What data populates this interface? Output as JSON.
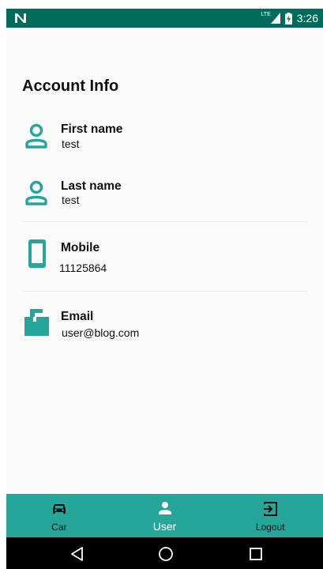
{
  "status_bar": {
    "time": "3:26",
    "network": "LTE",
    "left_icon": "notification-n-icon",
    "signal_icon": "signal-icon",
    "battery_icon": "battery-charging-icon"
  },
  "page": {
    "title": "Account Info"
  },
  "fields": [
    {
      "label": "First name",
      "value": "test",
      "icon": "person-icon"
    },
    {
      "label": "Last name",
      "value": "test",
      "icon": "person-icon"
    },
    {
      "label": "Mobile",
      "value": "11125864",
      "icon": "smartphone-icon"
    },
    {
      "label": "Email",
      "value": "user@blog.com",
      "icon": "mailbox-icon"
    }
  ],
  "bottom_nav": {
    "items": [
      {
        "label": "Car",
        "icon": "car-icon",
        "active": false
      },
      {
        "label": "User",
        "icon": "user-icon",
        "active": true
      },
      {
        "label": "Logout",
        "icon": "logout-icon",
        "active": false
      }
    ]
  },
  "system_nav": {
    "back_icon": "back-icon",
    "home_icon": "home-icon",
    "recents_icon": "recents-icon"
  },
  "colors": {
    "status_bar": "#006b5a",
    "accent": "#26a69a",
    "background": "#fafafa",
    "system_bar": "#000000"
  }
}
